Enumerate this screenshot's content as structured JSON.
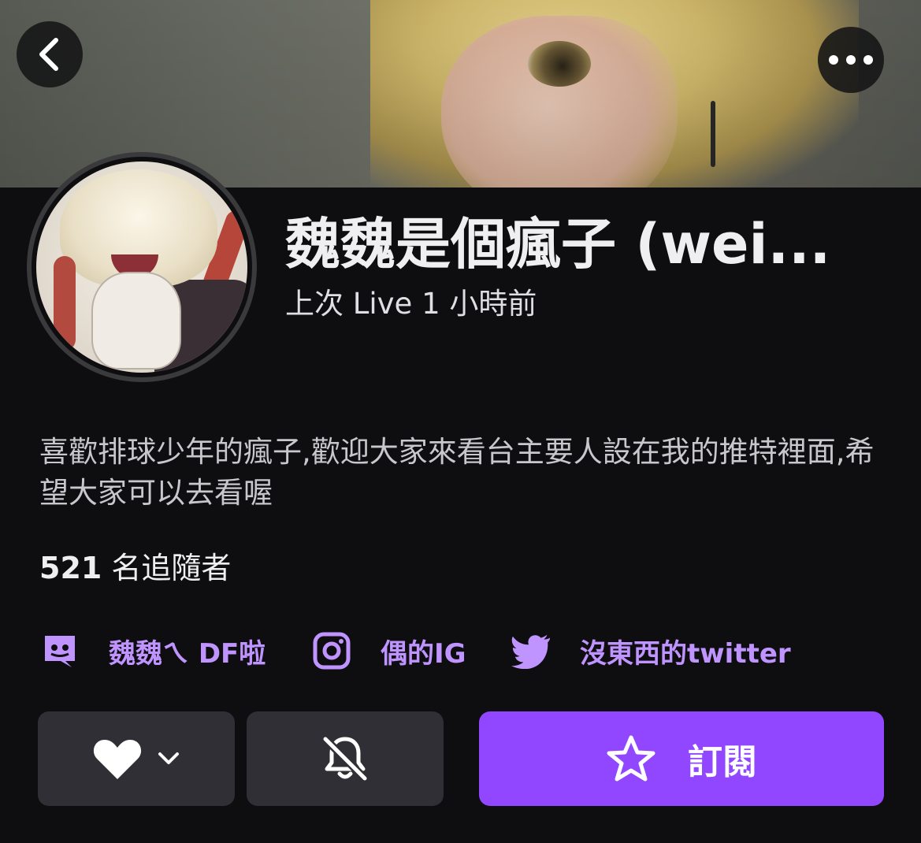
{
  "header": {
    "back_icon": "chevron-left-icon",
    "more_icon": "more-dots-icon"
  },
  "profile": {
    "channel_name": "魏魏是個瘋子 (wei...",
    "last_live": "上次 Live 1 小時前",
    "bio": "喜歡排球少年的瘋子,歡迎大家來看台主要人設在我的推特裡面,希望大家可以去看喔",
    "followers_count": "521",
    "followers_label": "名追隨者"
  },
  "links": [
    {
      "icon": "discord-icon",
      "label": "魏魏ㄟ DF啦"
    },
    {
      "icon": "instagram-icon",
      "label": "偶的IG"
    },
    {
      "icon": "twitter-icon",
      "label": "沒東西的twitter"
    }
  ],
  "actions": {
    "follow_icon": "heart-icon",
    "notifications_icon": "bell-off-icon",
    "subscribe_icon": "star-icon",
    "subscribe_label": "訂閱"
  },
  "colors": {
    "background": "#0e0e10",
    "accent": "#9147ff",
    "link": "#bf94ff",
    "button_secondary": "#2f2f35"
  }
}
